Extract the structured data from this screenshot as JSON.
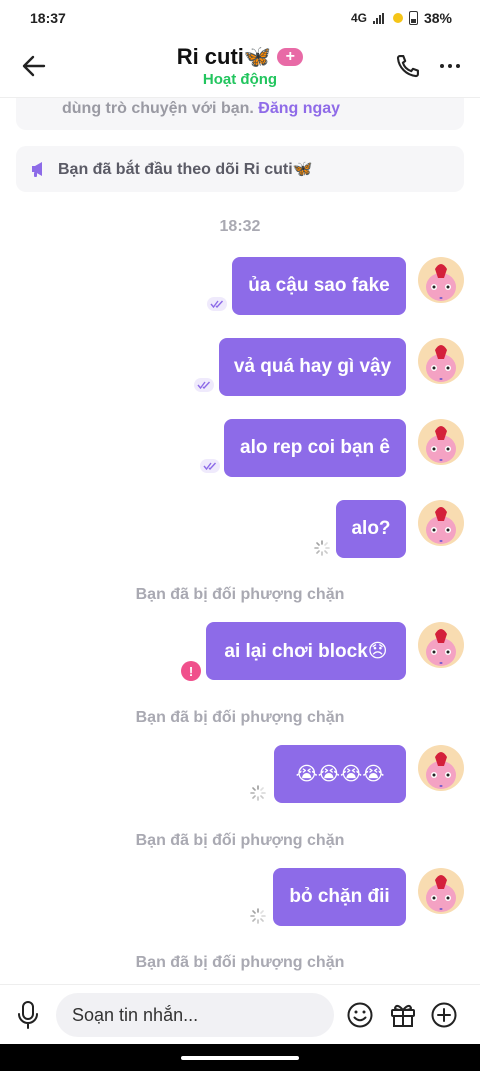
{
  "status_bar": {
    "time": "18:37",
    "network": "4G",
    "battery": "38%"
  },
  "header": {
    "contact_name": "Ri cuti🦋",
    "plus_badge": "+",
    "presence": "Hoạt động"
  },
  "notices": {
    "register_text": "dùng trò chuyện với bạn.",
    "register_link": "Đăng ngay",
    "follow_text": "Bạn đã bắt đầu theo dõi Ri cuti🦋"
  },
  "timestamp": "18:32",
  "messages": [
    {
      "text": "ủa cậu sao fake",
      "status": "sent"
    },
    {
      "text": "vả quá hay gì vậy",
      "status": "sent"
    },
    {
      "text": "alo rep coi bạn ê",
      "status": "sent"
    },
    {
      "text": "alo?",
      "status": "sending"
    },
    {
      "text": "ai lại chơi block😞",
      "status": "failed"
    },
    {
      "text": "😭😭😭😭",
      "status": "sending"
    },
    {
      "text": "bỏ chặn đii",
      "status": "sending"
    }
  ],
  "system_messages": [
    "Bạn đã bị đối phượng chặn",
    "Bạn đã bị đối phượng chặn",
    "Bạn đã bị đối phượng chặn",
    "Bạn đã bị đối phượng chặn"
  ],
  "composer": {
    "placeholder": "Soạn tin nhắn...",
    "value": ""
  },
  "icons": {
    "back": "arrow-left-icon",
    "call": "phone-icon",
    "more": "more-horizontal-icon",
    "mic": "mic-icon",
    "emoji": "smiley-icon",
    "gift": "gift-icon",
    "add": "plus-circle-icon",
    "seen": "double-check-icon",
    "sending": "spinner-icon",
    "error": "exclamation-icon"
  },
  "colors": {
    "accent": "#8d6be8",
    "online": "#22c55e",
    "error": "#f0508c",
    "badge": "#e86aa6"
  }
}
